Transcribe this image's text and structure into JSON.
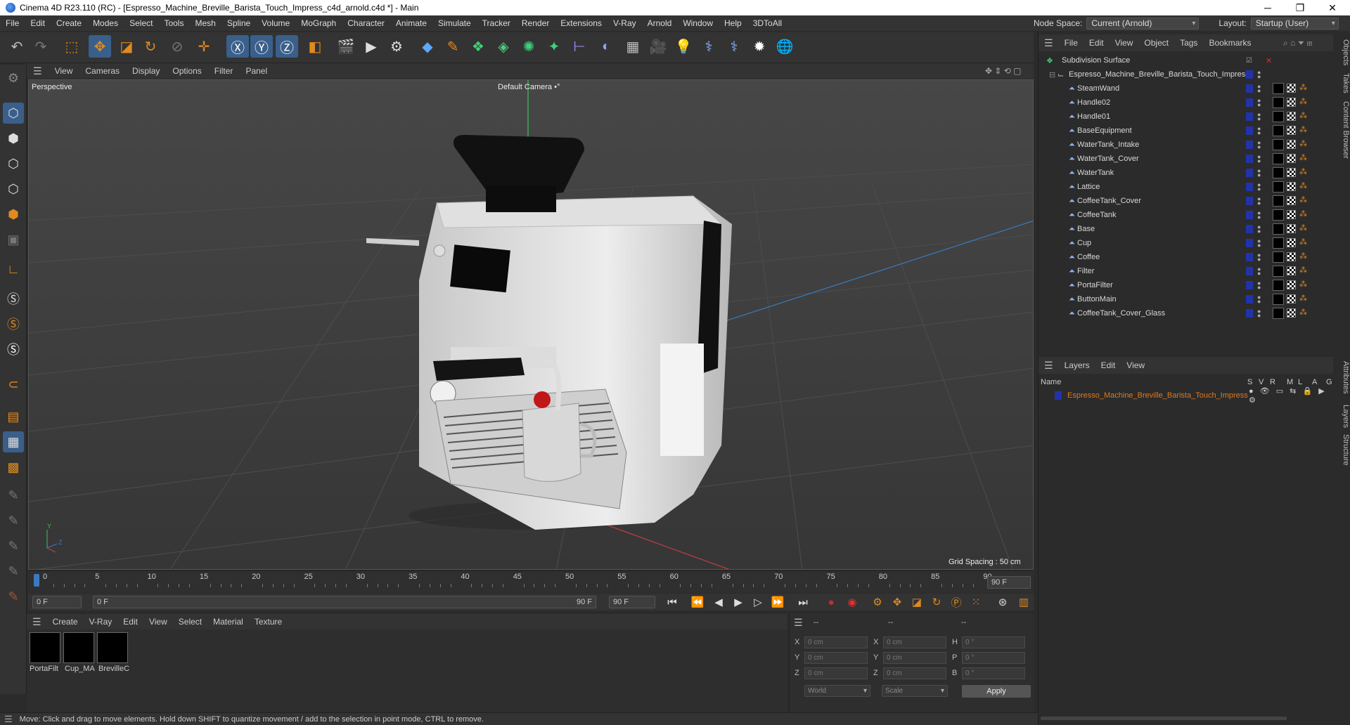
{
  "window": {
    "title": "Cinema 4D R23.110 (RC) - [Espresso_Machine_Breville_Barista_Touch_Impress_c4d_arnold.c4d *] - Main",
    "minimize": "─",
    "maximize": "❐",
    "close": "✕"
  },
  "menu": [
    "File",
    "Edit",
    "Create",
    "Modes",
    "Select",
    "Tools",
    "Mesh",
    "Spline",
    "Volume",
    "MoGraph",
    "Character",
    "Animate",
    "Simulate",
    "Tracker",
    "Render",
    "Extensions",
    "V-Ray",
    "Arnold",
    "Window",
    "Help",
    "3DToAll"
  ],
  "node_space": {
    "label": "Node Space:",
    "value": "Current (Arnold)"
  },
  "layout": {
    "label": "Layout:",
    "value": "Startup (User)"
  },
  "viewport": {
    "menu": [
      "View",
      "Cameras",
      "Display",
      "Options",
      "Filter",
      "Panel"
    ],
    "label": "Perspective",
    "camera": "Default Camera",
    "camera_icon": "•°",
    "grid_spacing": "Grid Spacing : 50 cm",
    "axis_y": "Y",
    "axis_z": "Z"
  },
  "timeline": {
    "ticks": [
      "0",
      "5",
      "10",
      "15",
      "20",
      "25",
      "30",
      "35",
      "40",
      "45",
      "50",
      "55",
      "60",
      "65",
      "70",
      "75",
      "80",
      "85",
      "90"
    ],
    "current": "0 F",
    "end_display": "90 F"
  },
  "transport": {
    "start": "0 F",
    "range_start": "0 F",
    "range_end": "90 F",
    "end": "90 F"
  },
  "materials": {
    "menu": [
      "Create",
      "V-Ray",
      "Edit",
      "View",
      "Select",
      "Material",
      "Texture"
    ],
    "items": [
      "PortaFilt",
      "Cup_MA",
      "BrevilleC"
    ]
  },
  "coords": {
    "header": [
      "--",
      "--",
      "--"
    ],
    "rows": [
      {
        "a": "X",
        "av": "0 cm",
        "b": "X",
        "bv": "0 cm",
        "c": "H",
        "cv": "0 °"
      },
      {
        "a": "Y",
        "av": "0 cm",
        "b": "Y",
        "bv": "0 cm",
        "c": "P",
        "cv": "0 °"
      },
      {
        "a": "Z",
        "av": "0 cm",
        "b": "Z",
        "bv": "0 cm",
        "c": "B",
        "cv": "0 °"
      }
    ],
    "world": "World",
    "scale": "Scale",
    "apply": "Apply"
  },
  "status": "Move: Click and drag to move elements. Hold down SHIFT to quantize movement / add to the selection in point mode, CTRL to remove.",
  "objects": {
    "menu": [
      "File",
      "Edit",
      "View",
      "Object",
      "Tags",
      "Bookmarks"
    ],
    "root": "Subdivision Surface",
    "group": "Espresso_Machine_Breville_Barista_Touch_Impress",
    "children": [
      "SteamWand",
      "Handle02",
      "Handle01",
      "BaseEquipment",
      "WaterTank_Intake",
      "WaterTank_Cover",
      "WaterTank",
      "Lattice",
      "CoffeeTank_Cover",
      "CoffeeTank",
      "Base",
      "Cup",
      "Coffee",
      "Filter",
      "PortaFilter",
      "ButtonMain",
      "CoffeeTank_Cover_Glass"
    ]
  },
  "layers": {
    "menu": [
      "Layers",
      "Edit",
      "View"
    ],
    "col_name": "Name",
    "cols": [
      "S",
      "V",
      "R",
      "M",
      "L",
      "A",
      "G"
    ],
    "item": "Espresso_Machine_Breville_Barista_Touch_Impress",
    "item_color": "#e07a1a"
  },
  "side_tabs": [
    "Objects",
    "Takes",
    "Content Browser",
    "Attributes",
    "Layers",
    "Structure"
  ],
  "colors": {
    "accent": "#3a5f8a",
    "layer_blue": "#2233aa",
    "orange": "#e08a20"
  }
}
